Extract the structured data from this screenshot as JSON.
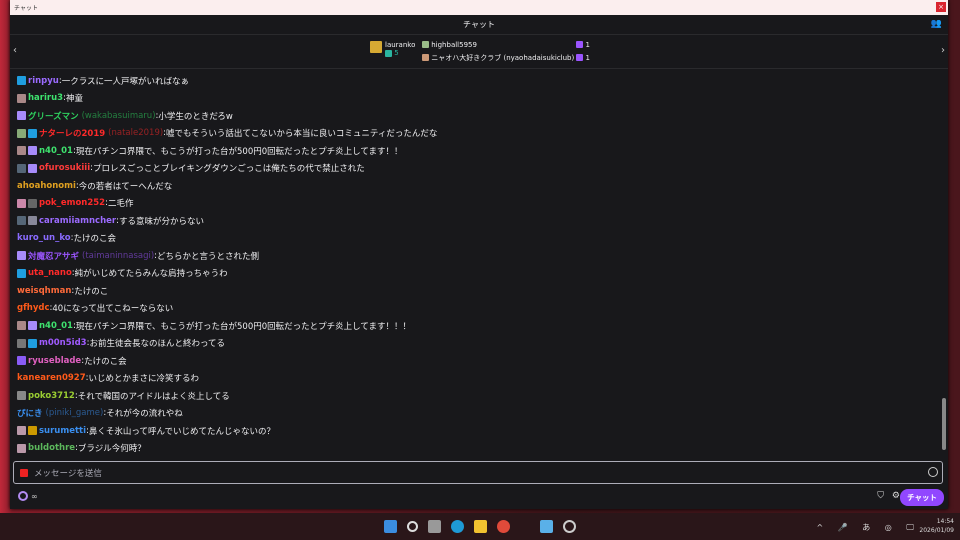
{
  "window": {
    "title": "チャット",
    "close": "×"
  },
  "header": {
    "title": "チャット"
  },
  "pinned": {
    "top_gifter": "lauranko",
    "top_gifter_count": "5",
    "gifters": [
      {
        "name": "highball5959",
        "count": "1"
      },
      {
        "name": "ニャオハ大好きクラブ (nyaohadaisukiclub)",
        "count": "1"
      }
    ]
  },
  "messages": [
    {
      "user": "rinpyu",
      "color": "#9b6bff",
      "badges": [
        "#1f9ee0"
      ],
      "text": "一クラスに一人戸塚がいればなぁ"
    },
    {
      "user": "hariru3",
      "color": "#3ee26e",
      "badges": [
        "#a88"
      ],
      "text": "神童"
    },
    {
      "user": "グリーズマン",
      "login": "(wakabasuimaru)",
      "color": "#2ed15e",
      "badges": [
        "#a78bfa"
      ],
      "text": "小学生のときだろw"
    },
    {
      "user": "ナターレの2019",
      "login": "(natale2019)",
      "color": "#ff2a2a",
      "badges": [
        "#8a7",
        "#1f9ee0"
      ],
      "text": "嘘でもそういう話出てこないから本当に良いコミュニティだったんだな"
    },
    {
      "user": "n40_01",
      "color": "#3ee26e",
      "badges": [
        "#a88",
        "#a78bfa"
      ],
      "text": "現在パチンコ界隈で、もこうが打った台が500円0回転だったとプチ炎上してます！！"
    },
    {
      "user": "ofurosukiii",
      "color": "#ff3a3a",
      "badges": [
        "#567",
        "#a78bfa"
      ],
      "text": "プロレスごっことブレイキングダウンごっこは俺たちの代で禁止された"
    },
    {
      "user": "ahoahonomi",
      "color": "#e0a020",
      "badges": [],
      "text": "今の若者はてーへんだな"
    },
    {
      "user": "pok_emon252",
      "color": "#ff2a2a",
      "badges": [
        "#c8a",
        "#666"
      ],
      "text": "二毛作"
    },
    {
      "user": "caramiiamncher",
      "color": "#9b6bff",
      "badges": [
        "#567",
        "#889"
      ],
      "text": "する意味が分からない"
    },
    {
      "user": "kuro_un_ko",
      "color": "#8a6bff",
      "badges": [],
      "text": "たけのこ会"
    },
    {
      "user": "対魔忍アサギ",
      "login": "(taimaninnasagi)",
      "color": "#9b55ff",
      "badges": [
        "#a78bfa"
      ],
      "text": "どちらかと言うとされた側"
    },
    {
      "user": "uta_nano",
      "color": "#ff2a2a",
      "badges": [
        "#1f9ee0"
      ],
      "text": "純がいじめてたらみんな肩持っちゃうわ"
    },
    {
      "user": "weisqhman",
      "color": "#ff6a3a",
      "badges": [],
      "text": "たけのこ"
    },
    {
      "user": "gfhydc",
      "color": "#ff5a1a",
      "badges": [],
      "text": "40になって出てこねーならない"
    },
    {
      "user": "n40_01",
      "color": "#3ee26e",
      "badges": [
        "#a88",
        "#a78bfa"
      ],
      "text": "現在パチンコ界隈で、もこうが打った台が500円0回転だったとプチ炎上してます！！！"
    },
    {
      "user": "m00n5id3",
      "color": "#a05bff",
      "badges": [
        "#777",
        "#1f9ee0"
      ],
      "text": "お前生徒会長なのほんと終わってる"
    },
    {
      "user": "ryuseblade",
      "color": "#e060c0",
      "badges": [
        "#8a5cf6"
      ],
      "text": "たけのこ会"
    },
    {
      "user": "kanearen0927",
      "color": "#ff5a1a",
      "badges": [],
      "text": "いじめとかまさに冷笑するわ"
    },
    {
      "user": "poko3712",
      "color": "#9acd32",
      "badges": [
        "#888"
      ],
      "text": "それで韓国のアイドルはよく炎上してる"
    },
    {
      "user": "ぴにき",
      "login": "(piniki_game)",
      "color": "#3a8ff0",
      "badges": [],
      "text": "それが今の流れやね"
    },
    {
      "user": "surumetti",
      "color": "#3a8ff0",
      "badges": [
        "#b9a",
        "#c90"
      ],
      "text": "鼻くそ氷山って呼んでいじめてたんじゃないの？"
    },
    {
      "user": "buldothre",
      "color": "#5cb85c",
      "badges": [
        "#b9a"
      ],
      "text": "ブラジル今何時？"
    }
  ],
  "input": {
    "placeholder": "メッセージを送信"
  },
  "bottom": {
    "points": "∞",
    "send": "チャット"
  },
  "taskbar": {
    "time": "14:54",
    "date": "2026/01/09",
    "ime": "あ"
  }
}
